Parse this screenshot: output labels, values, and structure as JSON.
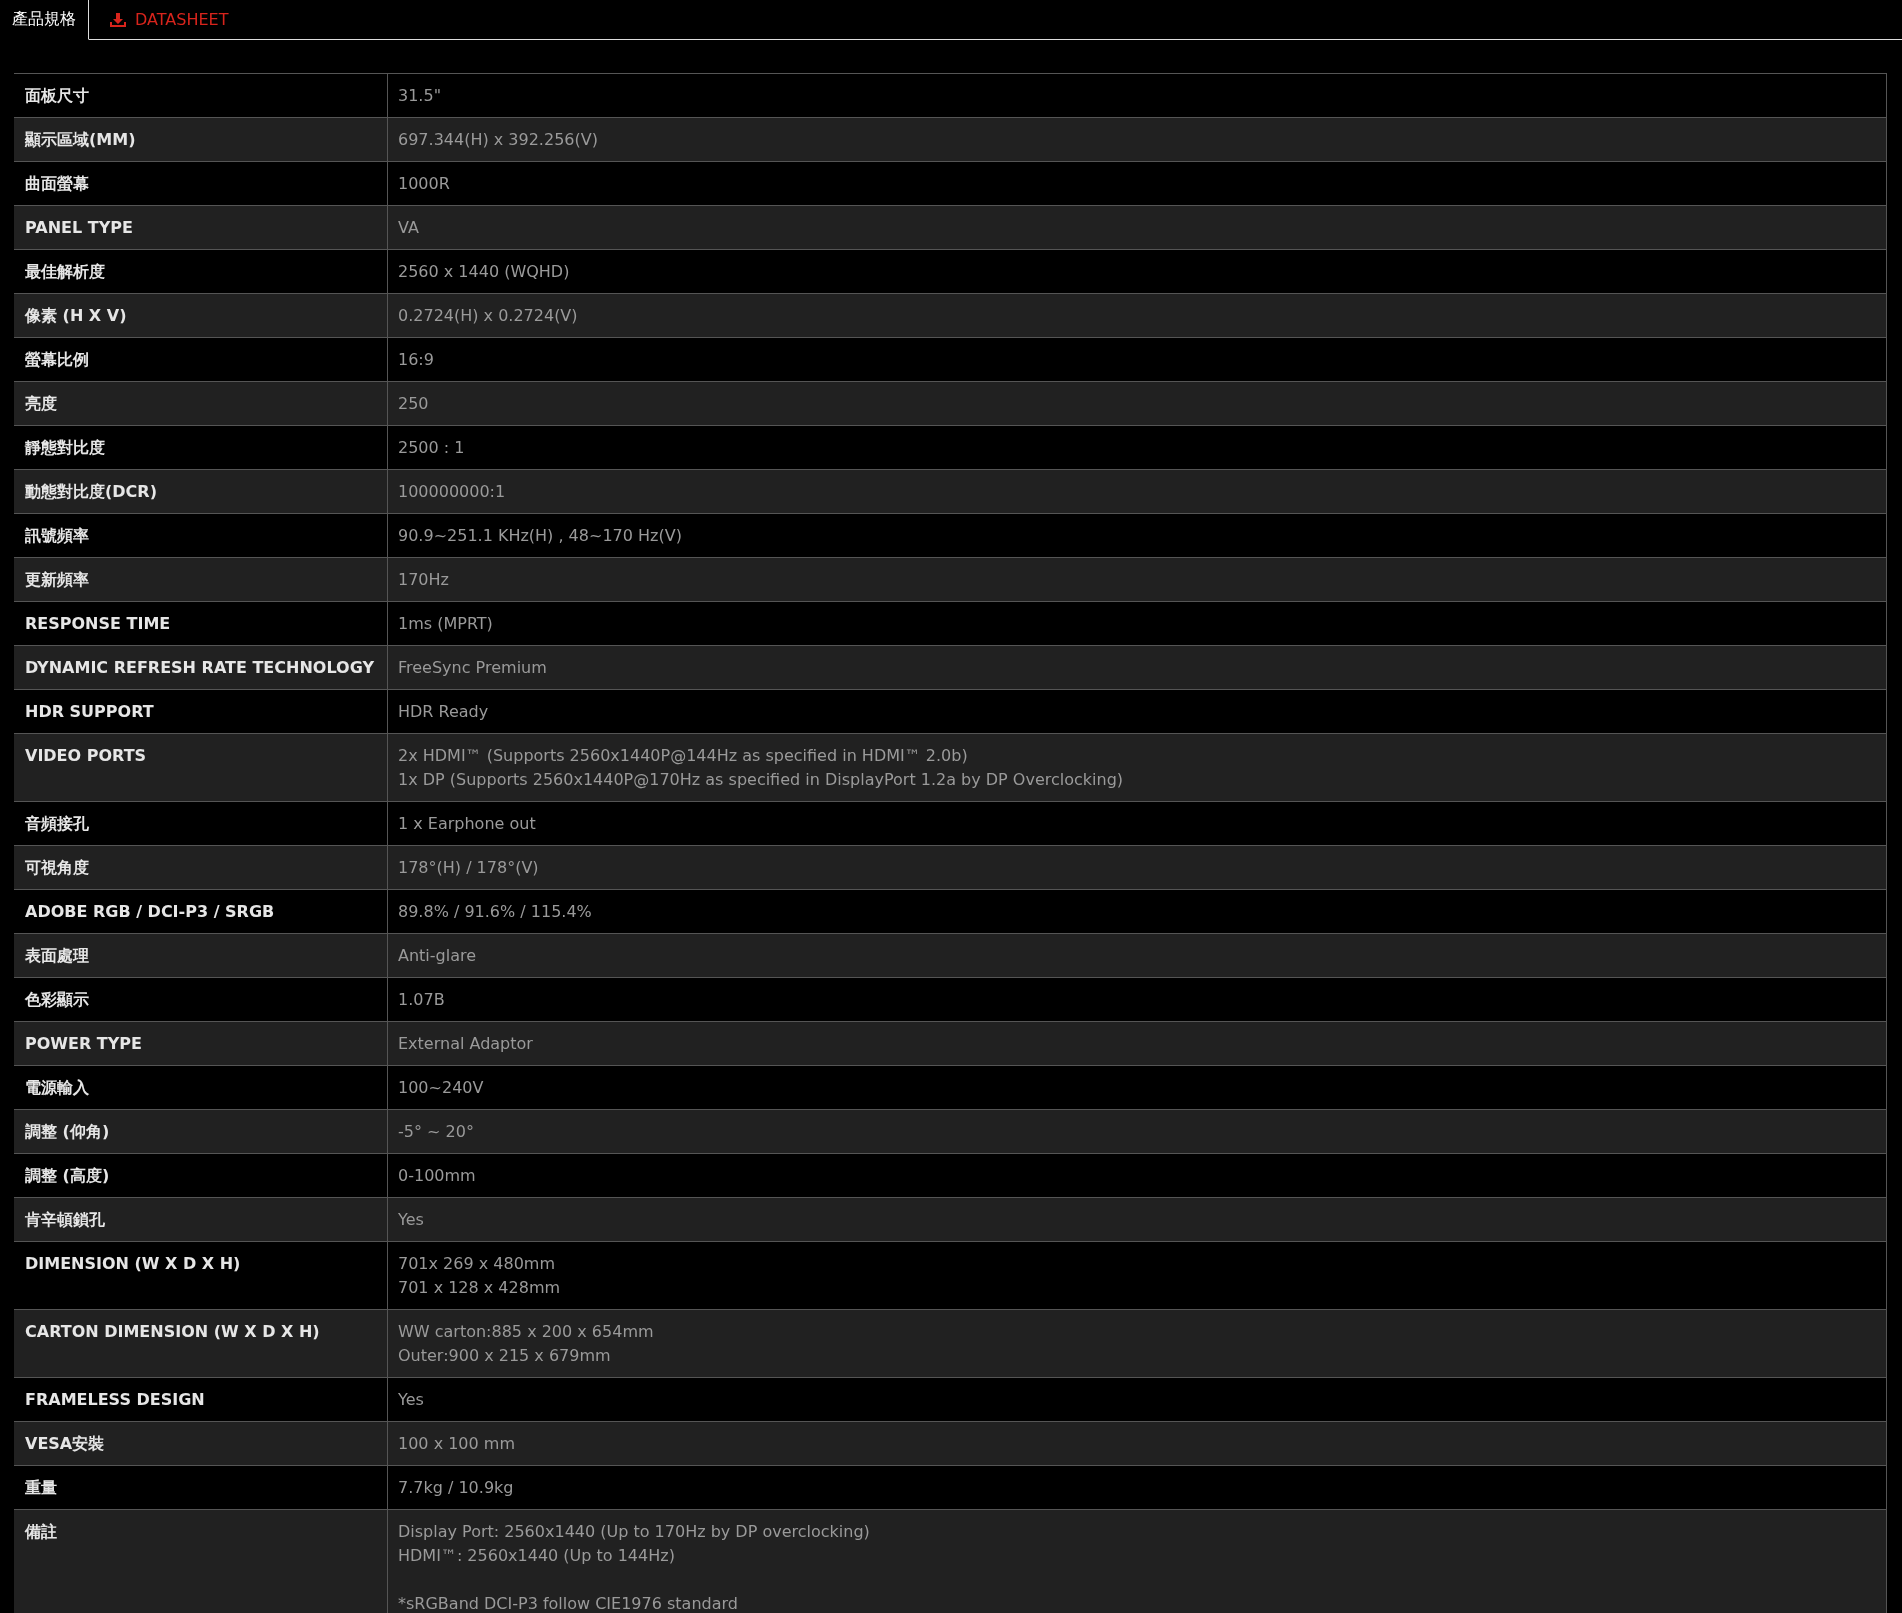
{
  "tabs": [
    {
      "kind": "tab",
      "label": "產品規格",
      "selected": true
    },
    {
      "kind": "download-link",
      "label": "DATASHEET",
      "selected": false
    }
  ],
  "specs": [
    {
      "label": "面板尺寸",
      "paragraphs": [
        [
          "31.5\""
        ]
      ]
    },
    {
      "label": "顯示區域(MM)",
      "paragraphs": [
        [
          "697.344(H) x 392.256(V)"
        ]
      ]
    },
    {
      "label": "曲面螢幕",
      "paragraphs": [
        [
          "1000R"
        ]
      ]
    },
    {
      "label": "PANEL TYPE",
      "paragraphs": [
        [
          "VA"
        ]
      ]
    },
    {
      "label": "最佳解析度",
      "paragraphs": [
        [
          "2560 x 1440 (WQHD)"
        ]
      ]
    },
    {
      "label": "像素 (H X V)",
      "paragraphs": [
        [
          "0.2724(H) x 0.2724(V)"
        ]
      ]
    },
    {
      "label": "螢幕比例",
      "paragraphs": [
        [
          "16:9"
        ]
      ]
    },
    {
      "label": "亮度",
      "paragraphs": [
        [
          "250"
        ]
      ]
    },
    {
      "label": "靜態對比度",
      "paragraphs": [
        [
          "2500 : 1"
        ]
      ]
    },
    {
      "label": "動態對比度(DCR)",
      "paragraphs": [
        [
          "100000000:1"
        ]
      ]
    },
    {
      "label": "訊號頻率",
      "paragraphs": [
        [
          "90.9~251.1 KHz(H) , 48~170 Hz(V)"
        ]
      ]
    },
    {
      "label": "更新頻率",
      "paragraphs": [
        [
          "170Hz"
        ]
      ]
    },
    {
      "label": "RESPONSE TIME",
      "paragraphs": [
        [
          "1ms (MPRT)"
        ]
      ]
    },
    {
      "label": "DYNAMIC REFRESH RATE TECHNOLOGY",
      "paragraphs": [
        [
          "FreeSync Premium"
        ]
      ]
    },
    {
      "label": "HDR SUPPORT",
      "paragraphs": [
        [
          "HDR Ready"
        ]
      ]
    },
    {
      "label": "VIDEO PORTS",
      "paragraphs": [
        [
          "2x HDMI™ (Supports 2560x1440P@144Hz as specified in HDMI™ 2.0b)",
          "1x DP (Supports 2560x1440P@170Hz as specified in DisplayPort 1.2a by DP Overclocking)"
        ]
      ]
    },
    {
      "label": "音頻接孔",
      "paragraphs": [
        [
          "1 x Earphone out"
        ]
      ]
    },
    {
      "label": "可視角度",
      "paragraphs": [
        [
          "178°(H) / 178°(V)"
        ]
      ]
    },
    {
      "label": "ADOBE RGB / DCI-P3 / SRGB",
      "paragraphs": [
        [
          "89.8% / 91.6% / 115.4%"
        ]
      ]
    },
    {
      "label": "表面處理",
      "paragraphs": [
        [
          "Anti-glare"
        ]
      ]
    },
    {
      "label": "色彩顯示",
      "paragraphs": [
        [
          "1.07B"
        ]
      ]
    },
    {
      "label": "POWER TYPE",
      "paragraphs": [
        [
          "External Adaptor"
        ]
      ]
    },
    {
      "label": "電源輸入",
      "paragraphs": [
        [
          "100~240V"
        ]
      ]
    },
    {
      "label": "調整 (仰角)",
      "paragraphs": [
        [
          "-5° ~ 20°"
        ]
      ]
    },
    {
      "label": "調整 (高度)",
      "paragraphs": [
        [
          "0-100mm"
        ]
      ]
    },
    {
      "label": "肯辛頓鎖孔",
      "paragraphs": [
        [
          "Yes"
        ]
      ]
    },
    {
      "label": "DIMENSION (W X D X H)",
      "paragraphs": [
        [
          "701x 269 x 480mm",
          "701 x 128 x 428mm"
        ]
      ]
    },
    {
      "label": "CARTON DIMENSION (W X D X H)",
      "paragraphs": [
        [
          "WW carton:885 x 200 x 654mm",
          "Outer:900 x 215 x 679mm"
        ]
      ]
    },
    {
      "label": "FRAMELESS DESIGN",
      "paragraphs": [
        [
          "Yes"
        ]
      ]
    },
    {
      "label": "VESA安裝",
      "paragraphs": [
        [
          "100 x 100 mm"
        ]
      ]
    },
    {
      "label": "重量",
      "paragraphs": [
        [
          "7.7kg / 10.9kg"
        ]
      ]
    },
    {
      "label": "備註",
      "paragraphs": [
        [
          "Display Port: 2560x1440 (Up to 170Hz by DP overclocking)",
          "HDMI™: 2560x1440 (Up to 144Hz)"
        ],
        [
          "*sRGBand DCI-P3 follow CIE1976 standard"
        ]
      ]
    }
  ]
}
